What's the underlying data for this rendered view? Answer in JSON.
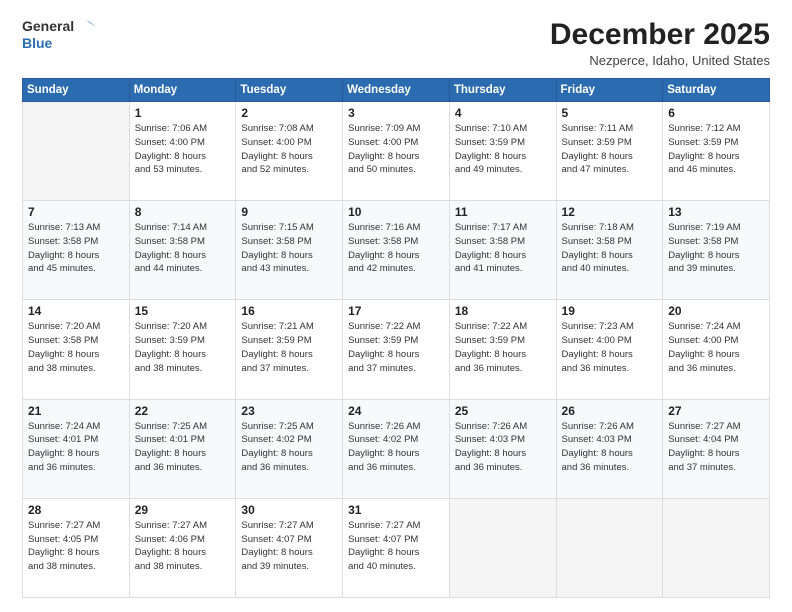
{
  "header": {
    "logo": {
      "line1": "General",
      "line2": "Blue"
    },
    "month": "December 2025",
    "location": "Nezperce, Idaho, United States"
  },
  "weekdays": [
    "Sunday",
    "Monday",
    "Tuesday",
    "Wednesday",
    "Thursday",
    "Friday",
    "Saturday"
  ],
  "weeks": [
    [
      {
        "day": "",
        "info": ""
      },
      {
        "day": "1",
        "info": "Sunrise: 7:06 AM\nSunset: 4:00 PM\nDaylight: 8 hours\nand 53 minutes."
      },
      {
        "day": "2",
        "info": "Sunrise: 7:08 AM\nSunset: 4:00 PM\nDaylight: 8 hours\nand 52 minutes."
      },
      {
        "day": "3",
        "info": "Sunrise: 7:09 AM\nSunset: 4:00 PM\nDaylight: 8 hours\nand 50 minutes."
      },
      {
        "day": "4",
        "info": "Sunrise: 7:10 AM\nSunset: 3:59 PM\nDaylight: 8 hours\nand 49 minutes."
      },
      {
        "day": "5",
        "info": "Sunrise: 7:11 AM\nSunset: 3:59 PM\nDaylight: 8 hours\nand 47 minutes."
      },
      {
        "day": "6",
        "info": "Sunrise: 7:12 AM\nSunset: 3:59 PM\nDaylight: 8 hours\nand 46 minutes."
      }
    ],
    [
      {
        "day": "7",
        "info": "Sunrise: 7:13 AM\nSunset: 3:58 PM\nDaylight: 8 hours\nand 45 minutes."
      },
      {
        "day": "8",
        "info": "Sunrise: 7:14 AM\nSunset: 3:58 PM\nDaylight: 8 hours\nand 44 minutes."
      },
      {
        "day": "9",
        "info": "Sunrise: 7:15 AM\nSunset: 3:58 PM\nDaylight: 8 hours\nand 43 minutes."
      },
      {
        "day": "10",
        "info": "Sunrise: 7:16 AM\nSunset: 3:58 PM\nDaylight: 8 hours\nand 42 minutes."
      },
      {
        "day": "11",
        "info": "Sunrise: 7:17 AM\nSunset: 3:58 PM\nDaylight: 8 hours\nand 41 minutes."
      },
      {
        "day": "12",
        "info": "Sunrise: 7:18 AM\nSunset: 3:58 PM\nDaylight: 8 hours\nand 40 minutes."
      },
      {
        "day": "13",
        "info": "Sunrise: 7:19 AM\nSunset: 3:58 PM\nDaylight: 8 hours\nand 39 minutes."
      }
    ],
    [
      {
        "day": "14",
        "info": "Sunrise: 7:20 AM\nSunset: 3:58 PM\nDaylight: 8 hours\nand 38 minutes."
      },
      {
        "day": "15",
        "info": "Sunrise: 7:20 AM\nSunset: 3:59 PM\nDaylight: 8 hours\nand 38 minutes."
      },
      {
        "day": "16",
        "info": "Sunrise: 7:21 AM\nSunset: 3:59 PM\nDaylight: 8 hours\nand 37 minutes."
      },
      {
        "day": "17",
        "info": "Sunrise: 7:22 AM\nSunset: 3:59 PM\nDaylight: 8 hours\nand 37 minutes."
      },
      {
        "day": "18",
        "info": "Sunrise: 7:22 AM\nSunset: 3:59 PM\nDaylight: 8 hours\nand 36 minutes."
      },
      {
        "day": "19",
        "info": "Sunrise: 7:23 AM\nSunset: 4:00 PM\nDaylight: 8 hours\nand 36 minutes."
      },
      {
        "day": "20",
        "info": "Sunrise: 7:24 AM\nSunset: 4:00 PM\nDaylight: 8 hours\nand 36 minutes."
      }
    ],
    [
      {
        "day": "21",
        "info": "Sunrise: 7:24 AM\nSunset: 4:01 PM\nDaylight: 8 hours\nand 36 minutes."
      },
      {
        "day": "22",
        "info": "Sunrise: 7:25 AM\nSunset: 4:01 PM\nDaylight: 8 hours\nand 36 minutes."
      },
      {
        "day": "23",
        "info": "Sunrise: 7:25 AM\nSunset: 4:02 PM\nDaylight: 8 hours\nand 36 minutes."
      },
      {
        "day": "24",
        "info": "Sunrise: 7:26 AM\nSunset: 4:02 PM\nDaylight: 8 hours\nand 36 minutes."
      },
      {
        "day": "25",
        "info": "Sunrise: 7:26 AM\nSunset: 4:03 PM\nDaylight: 8 hours\nand 36 minutes."
      },
      {
        "day": "26",
        "info": "Sunrise: 7:26 AM\nSunset: 4:03 PM\nDaylight: 8 hours\nand 36 minutes."
      },
      {
        "day": "27",
        "info": "Sunrise: 7:27 AM\nSunset: 4:04 PM\nDaylight: 8 hours\nand 37 minutes."
      }
    ],
    [
      {
        "day": "28",
        "info": "Sunrise: 7:27 AM\nSunset: 4:05 PM\nDaylight: 8 hours\nand 38 minutes."
      },
      {
        "day": "29",
        "info": "Sunrise: 7:27 AM\nSunset: 4:06 PM\nDaylight: 8 hours\nand 38 minutes."
      },
      {
        "day": "30",
        "info": "Sunrise: 7:27 AM\nSunset: 4:07 PM\nDaylight: 8 hours\nand 39 minutes."
      },
      {
        "day": "31",
        "info": "Sunrise: 7:27 AM\nSunset: 4:07 PM\nDaylight: 8 hours\nand 40 minutes."
      },
      {
        "day": "",
        "info": ""
      },
      {
        "day": "",
        "info": ""
      },
      {
        "day": "",
        "info": ""
      }
    ]
  ]
}
